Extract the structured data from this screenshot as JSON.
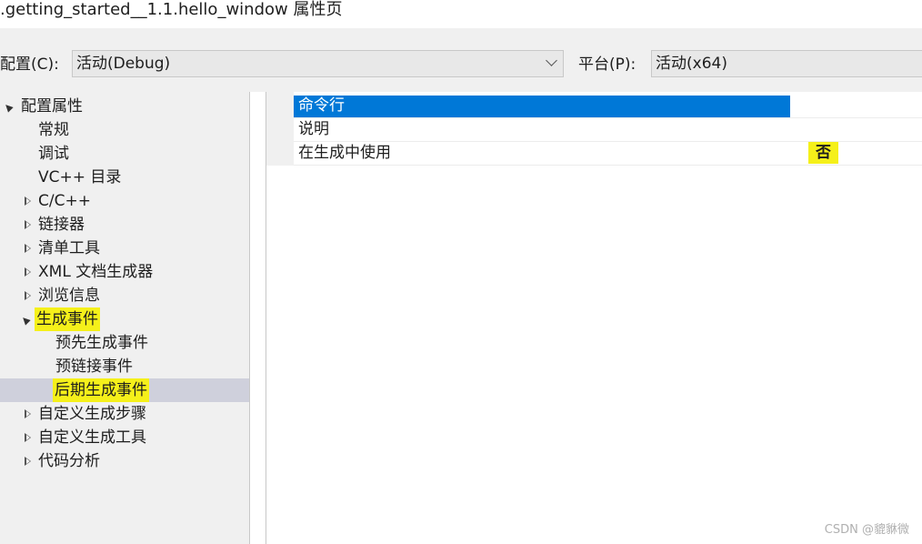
{
  "window": {
    "title": ".getting_started__1.1.hello_window 属性页"
  },
  "config_bar": {
    "config_label": "配置(C):",
    "config_value": "活动(Debug)",
    "platform_label": "平台(P):",
    "platform_value": "活动(x64)"
  },
  "tree": {
    "root": "配置属性",
    "items": [
      {
        "label": "常规"
      },
      {
        "label": "调试"
      },
      {
        "label": "VC++ 目录"
      },
      {
        "label": "C/C++"
      },
      {
        "label": "链接器"
      },
      {
        "label": "清单工具"
      },
      {
        "label": "XML 文档生成器"
      },
      {
        "label": "浏览信息"
      },
      {
        "label": "生成事件"
      },
      {
        "label": "预先生成事件"
      },
      {
        "label": "预链接事件"
      },
      {
        "label": "后期生成事件"
      },
      {
        "label": "自定义生成步骤"
      },
      {
        "label": "自定义生成工具"
      },
      {
        "label": "代码分析"
      }
    ]
  },
  "properties": {
    "rows": [
      {
        "name": "命令行",
        "value": ""
      },
      {
        "name": "说明",
        "value": ""
      },
      {
        "name": "在生成中使用",
        "value": "否"
      }
    ]
  },
  "watermark": "CSDN @貔貅微",
  "colors": {
    "selection_blue": "#0078d7",
    "highlight_yellow": "#f5f01a",
    "selected_tree_bg": "#cfd0dc"
  }
}
